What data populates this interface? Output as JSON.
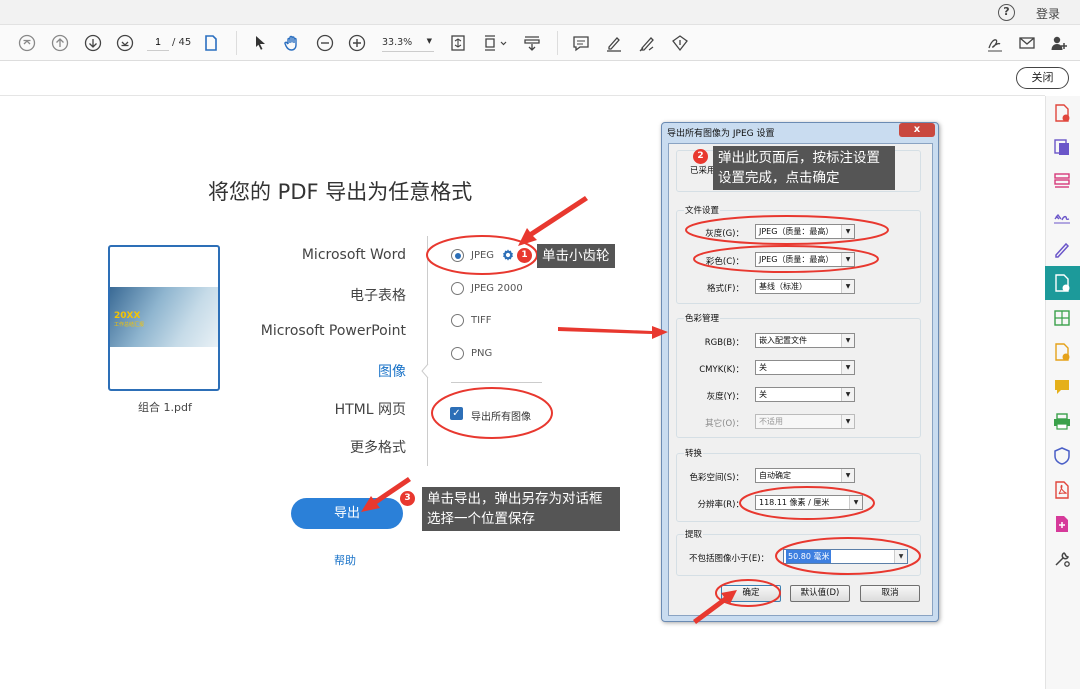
{
  "topbar": {
    "login": "登录"
  },
  "toolbar": {
    "page_current": "1",
    "page_total": "/ 45",
    "zoom": "33.3%"
  },
  "subbar": {
    "close_label": "关闭"
  },
  "main": {
    "title": "将您的 PDF 导出为任意格式",
    "thumbnail": {
      "label": "组合 1.pdf",
      "cover_title": "20XX",
      "cover_sub": "工作总结汇报"
    },
    "formats": [
      "Microsoft Word",
      "电子表格",
      "Microsoft PowerPoint",
      "图像",
      "HTML 网页",
      "更多格式"
    ],
    "active_format": "图像",
    "image_options": [
      "JPEG",
      "JPEG 2000",
      "TIFF",
      "PNG"
    ],
    "selected_option": "JPEG",
    "export_all_label": "导出所有图像",
    "export_all_checked": true,
    "export_button": "导出",
    "help_link": "帮助"
  },
  "callouts": [
    {
      "num": "1",
      "text": "单击小齿轮"
    },
    {
      "num": "2",
      "text_line1": "弹出此页面后，按标注设置",
      "text_line2": "设置完成，点击确定"
    },
    {
      "num": "3",
      "text_line1": "单击导出，弹出另存为对话框",
      "text_line2": "选择一个位置保存"
    }
  ],
  "dialog": {
    "title": "导出所有图像为 JPEG 设置",
    "close": "x",
    "preset_label": "已采用",
    "file_group": {
      "title": "文件设置",
      "rows": [
        {
          "label": "灰度(G)：",
          "value": "JPEG（质量：最高）"
        },
        {
          "label": "彩色(C)：",
          "value": "JPEG（质量：最高）"
        },
        {
          "label": "格式(F)：",
          "value": "基线（标准）"
        }
      ]
    },
    "color_group": {
      "title": "色彩管理",
      "rows": [
        {
          "label": "RGB(B)：",
          "value": "嵌入配置文件"
        },
        {
          "label": "CMYK(K)：",
          "value": "关"
        },
        {
          "label": "灰度(Y)：",
          "value": "关"
        },
        {
          "label": "其它(O)：",
          "value": "不适用"
        }
      ]
    },
    "convert_group": {
      "title": "转换",
      "rows": [
        {
          "label": "色彩空间(S)：",
          "value": "自动确定"
        },
        {
          "label": "分辨率(R)：",
          "value": "118.11 像素 / 厘米"
        }
      ]
    },
    "extract_group": {
      "title": "提取",
      "row": {
        "label": "不包括图像小于(E)：",
        "value": "50.80 毫米"
      }
    },
    "buttons": {
      "ok": "确定",
      "defaults": "默认值(D)",
      "cancel": "取消"
    }
  },
  "colors": {
    "accent": "#2b80d8",
    "annotation": "#e8382f",
    "callout_bg": "#555555",
    "panel_active": "#1c9a9a"
  }
}
